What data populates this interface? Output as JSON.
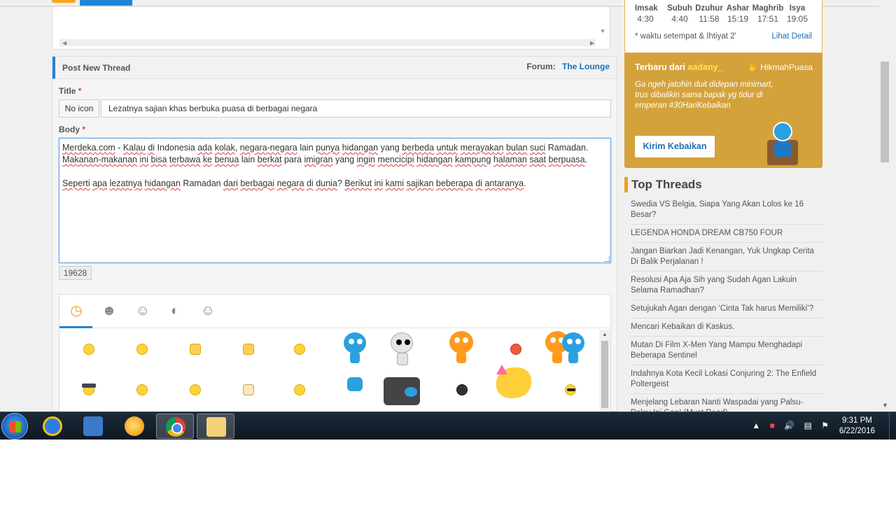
{
  "post": {
    "header_title": "Post New Thread",
    "forum_label": "Forum:",
    "forum_name": "The Lounge",
    "title_label": "Title",
    "required_mark": "*",
    "icon_button": "No icon",
    "title_value": "Lezatnya sajian khas berbuka puasa di berbagai negara",
    "body_label": "Body",
    "body_para1": [
      {
        "t": "Merdeka.com",
        "s": true
      },
      {
        "t": " - ",
        "s": false
      },
      {
        "t": "Kalau",
        "s": true
      },
      {
        "t": " ",
        "s": false
      },
      {
        "t": "di",
        "s": true
      },
      {
        "t": " Indonesia ",
        "s": false
      },
      {
        "t": "ada",
        "s": true
      },
      {
        "t": " ",
        "s": false
      },
      {
        "t": "kolak",
        "s": true
      },
      {
        "t": ", ",
        "s": false
      },
      {
        "t": "negara-negara",
        "s": true
      },
      {
        "t": " lain ",
        "s": false
      },
      {
        "t": "punya",
        "s": true
      },
      {
        "t": " ",
        "s": false
      },
      {
        "t": "hidangan",
        "s": true
      },
      {
        "t": " yang ",
        "s": false
      },
      {
        "t": "berbeda",
        "s": true
      },
      {
        "t": " ",
        "s": false
      },
      {
        "t": "untuk",
        "s": true
      },
      {
        "t": " ",
        "s": false
      },
      {
        "t": "merayakan",
        "s": true
      },
      {
        "t": " ",
        "s": false
      },
      {
        "t": "bulan",
        "s": true
      },
      {
        "t": " ",
        "s": false
      },
      {
        "t": "suci",
        "s": true
      },
      {
        "t": " Ramadan.",
        "s": false
      }
    ],
    "body_para2": [
      {
        "t": "Makanan-makanan",
        "s": true
      },
      {
        "t": " ",
        "s": false
      },
      {
        "t": "ini",
        "s": true
      },
      {
        "t": " ",
        "s": false
      },
      {
        "t": "bisa",
        "s": true
      },
      {
        "t": " ",
        "s": false
      },
      {
        "t": "terbawa",
        "s": true
      },
      {
        "t": " ",
        "s": false
      },
      {
        "t": "ke",
        "s": true
      },
      {
        "t": " ",
        "s": false
      },
      {
        "t": "benua",
        "s": true
      },
      {
        "t": " lain ",
        "s": false
      },
      {
        "t": "berkat",
        "s": true
      },
      {
        "t": " para ",
        "s": false
      },
      {
        "t": "imigran",
        "s": true
      },
      {
        "t": " yang ",
        "s": false
      },
      {
        "t": "ingin",
        "s": true
      },
      {
        "t": " ",
        "s": false
      },
      {
        "t": "mencicipi",
        "s": true
      },
      {
        "t": " ",
        "s": false
      },
      {
        "t": "hidangan",
        "s": true
      },
      {
        "t": " ",
        "s": false
      },
      {
        "t": "kampung",
        "s": true
      },
      {
        "t": " ",
        "s": false
      },
      {
        "t": "halaman",
        "s": true
      },
      {
        "t": " ",
        "s": false
      },
      {
        "t": "saat",
        "s": true
      },
      {
        "t": " ",
        "s": false
      },
      {
        "t": "berpuasa",
        "s": true
      },
      {
        "t": ".",
        "s": false
      }
    ],
    "body_para3": [
      {
        "t": "Seperti",
        "s": true
      },
      {
        "t": " ",
        "s": false
      },
      {
        "t": "apa",
        "s": true
      },
      {
        "t": " ",
        "s": false
      },
      {
        "t": "lezatnya",
        "s": true
      },
      {
        "t": " ",
        "s": false
      },
      {
        "t": "hidangan",
        "s": true
      },
      {
        "t": " Ramadan ",
        "s": false
      },
      {
        "t": "dari",
        "s": true
      },
      {
        "t": " ",
        "s": false
      },
      {
        "t": "berbagai",
        "s": true
      },
      {
        "t": " ",
        "s": false
      },
      {
        "t": "negara",
        "s": true
      },
      {
        "t": " ",
        "s": false
      },
      {
        "t": "di",
        "s": true
      },
      {
        "t": " ",
        "s": false
      },
      {
        "t": "dunia",
        "s": true
      },
      {
        "t": "? ",
        "s": false
      },
      {
        "t": "Berikut",
        "s": true
      },
      {
        "t": " ",
        "s": false
      },
      {
        "t": "ini",
        "s": true
      },
      {
        "t": " ",
        "s": false
      },
      {
        "t": "kami",
        "s": true
      },
      {
        "t": " ",
        "s": false
      },
      {
        "t": "sajikan",
        "s": true
      },
      {
        "t": " ",
        "s": false
      },
      {
        "t": "beberapa",
        "s": true
      },
      {
        "t": " ",
        "s": false
      },
      {
        "t": "di",
        "s": true
      },
      {
        "t": " ",
        "s": false
      },
      {
        "t": "antaranya",
        "s": true
      },
      {
        "t": ".",
        "s": false
      }
    ],
    "char_count": "19628"
  },
  "emoticons": {
    "tabs": [
      "clock-icon",
      "group-emoticon-icon",
      "character-emoticon-icon",
      "mouse-emoticon-icon",
      "grin-emoticon-icon"
    ],
    "row1": [
      "smile",
      "hug",
      "thumbs-up",
      "thumbs-down",
      "shocked",
      "blue-character",
      "white-character",
      "orange-character",
      "angry",
      "orange-blue-pair"
    ],
    "row2": [
      "hat",
      "surprised",
      "kiss",
      "hand",
      "neutral",
      "blue-face",
      "tuk-tuk",
      "bird",
      "birthday",
      "cool"
    ]
  },
  "prayer_times": {
    "names": [
      "Imsak",
      "Subuh",
      "Dzuhur",
      "Ashar",
      "Maghrib",
      "Isya"
    ],
    "times": [
      "4:30",
      "4:40",
      "11:58",
      "15:19",
      "17:51",
      "19:05"
    ],
    "note": "* waktu setempat & Ihtiyat 2'",
    "detail_link": "Lihat Detail"
  },
  "promo": {
    "prefix": "Terbaru dari",
    "user": "aadany_",
    "brand": "HikmahPuasa",
    "quote": "Ga ngeh jatohin duit didepan minimart, trus dibalikin sama bapak yg tidur di emperan #30HariKebaikan",
    "button": "Kirim Kebaikan",
    "accent": "#d4a23b"
  },
  "top_threads": {
    "title": "Top Threads",
    "items": [
      "Swedia VS Belgia, Siapa Yang Akan Lolos ke 16 Besar?",
      "LEGENDA HONDA DREAM CB750 FOUR",
      "Jangan Biarkan Jadi Kenangan, Yuk Ungkap Cerita Di Balik Perjalanan !",
      "Resolusi Apa Aja Sih yang Sudah Agan Lakuin Selama Ramadhan?",
      "Setujukah Agan dengan ‘Cinta Tak harus Memiliki’?",
      "Mencari Kebaikan di Kaskus.",
      "Mutan Di Film X-Men Yang Mampu Menghadapi Beberapa Sentinel",
      "Indahnya Kota Kecil Lokasi Conjuring 2: The Enfield Poltergeist",
      "Menjelang Lebaran Nanti Waspadai yang Palsu-Palsu Ini Gan! (Must Read)"
    ]
  },
  "taskbar": {
    "apps": [
      "internet-explorer-icon",
      "media-player-icon",
      "orb-app-icon",
      "chrome-icon",
      "file-explorer-icon"
    ],
    "time": "9:31 PM",
    "date": "6/22/2016"
  },
  "colors": {
    "link": "#1e6fb5",
    "accent_blue": "#1e84d8",
    "required": "#e03a3a"
  }
}
